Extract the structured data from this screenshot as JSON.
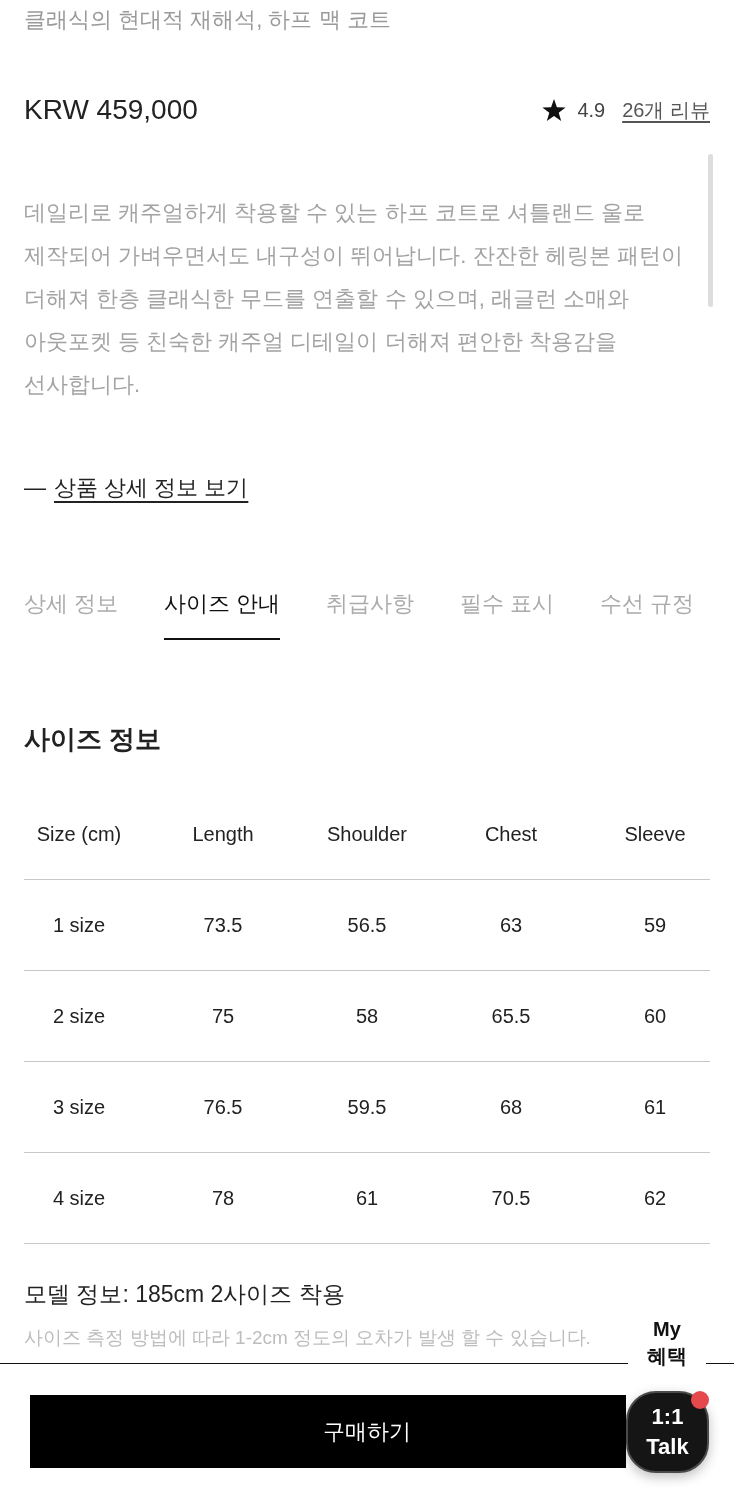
{
  "product": {
    "subtitle": "클래식의 현대적 재해석, 하프 맥 코트",
    "price": "KRW 459,000",
    "rating": "4.9",
    "reviews_link": "26개 리뷰",
    "description": "데일리로 캐주얼하게 착용할 수 있는 하프 코트로 셔틀랜드 울로 제작되어 가벼우면서도 내구성이 뛰어납니다. 잔잔한 헤링본 패턴이 더해져 한층 클래식한 무드를 연출할 수 있으며, 래글런 소매와 아웃포켓 등 친숙한 캐주얼 디테일이 더해져 편안한 착용감을 선사합니다.",
    "detail_link": {
      "prefix": "—",
      "label": "상품 상세 정보 보기"
    }
  },
  "tabs": [
    {
      "label": "상세 정보",
      "selected": false
    },
    {
      "label": "사이즈 안내",
      "selected": true
    },
    {
      "label": "취급사항",
      "selected": false
    },
    {
      "label": "필수 표시",
      "selected": false
    },
    {
      "label": "수선 규정",
      "selected": false
    }
  ],
  "size_info": {
    "title": "사이즈 정보",
    "table": {
      "columns": [
        "Size (cm)",
        "Length",
        "Shoulder",
        "Chest",
        "Sleeve"
      ],
      "rows": [
        [
          "1 size",
          "73.5",
          "56.5",
          "63",
          "59"
        ],
        [
          "2 size",
          "75",
          "58",
          "65.5",
          "60"
        ],
        [
          "3 size",
          "76.5",
          "59.5",
          "68",
          "61"
        ],
        [
          "4 size",
          "78",
          "61",
          "70.5",
          "62"
        ]
      ]
    },
    "model_info": "모델 정보: 185cm 2사이즈 착용",
    "note": "사이즈 측정 방법에 따라 1-2cm 정도의 오차가 발생 할 수 있습니다."
  },
  "bottom_bar": {
    "my_benefits": "My 혜택",
    "buy_button": "구매하기",
    "talk_button": {
      "label": "1:1 Talk",
      "has_notification": true
    }
  }
}
